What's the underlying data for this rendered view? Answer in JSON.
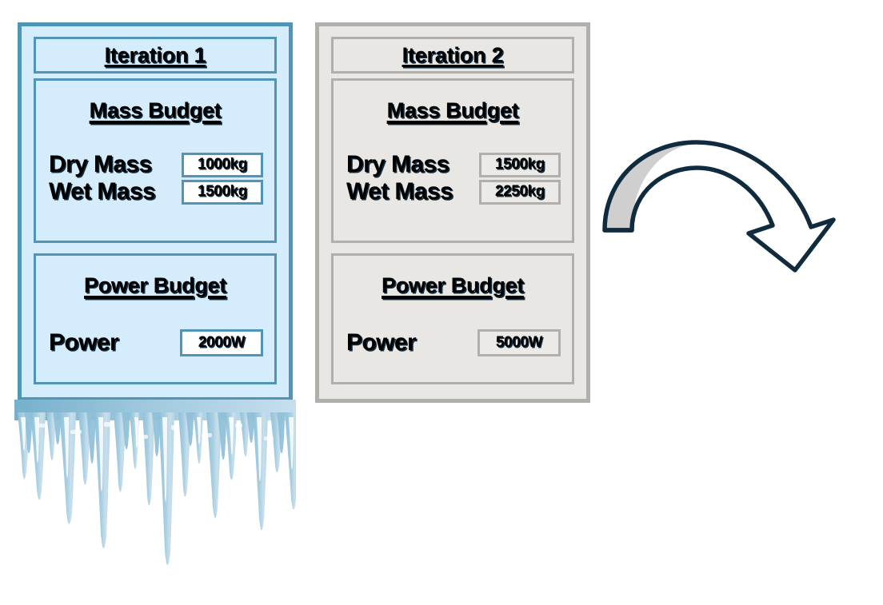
{
  "diagram": {
    "type": "iteration-comparison",
    "description": "Two iteration panels showing mass and power budgets, with a curved arrow indicating progression from iteration 1 to iteration 2. Iteration 1 panel is frozen/obsolete, depicted with icicles.",
    "colors": {
      "iter1_fill": "#d4ecfb",
      "iter1_border": "#4f95b8",
      "iter2_fill": "#e8e7e3",
      "iter2_border": "#b0afab",
      "value_box_fill_1": "#ffffff",
      "value_box_fill_2": "#eceae6",
      "arrow_outline": "#0f2b3d",
      "arrow_fill_left": "#cfcfcf",
      "arrow_fill_right": "#ffffff",
      "icicle_blue": "#8fc0d8",
      "icicle_light": "#c3dcea",
      "text": "#000000"
    }
  },
  "panels": [
    {
      "id": "iteration-1",
      "title": "Iteration 1",
      "sections": [
        {
          "id": "mass-budget",
          "heading": "Mass Budget",
          "rows": [
            {
              "label": "Dry Mass",
              "value": "1000kg"
            },
            {
              "label": "Wet Mass",
              "value": "1500kg"
            }
          ]
        },
        {
          "id": "power-budget",
          "heading": "Power Budget",
          "rows": [
            {
              "label": "Power",
              "value": "2000W"
            }
          ]
        }
      ]
    },
    {
      "id": "iteration-2",
      "title": "Iteration 2",
      "sections": [
        {
          "id": "mass-budget",
          "heading": "Mass Budget",
          "rows": [
            {
              "label": "Dry Mass",
              "value": "1500kg"
            },
            {
              "label": "Wet Mass",
              "value": "2250kg"
            }
          ]
        },
        {
          "id": "power-budget",
          "heading": "Power Budget",
          "rows": [
            {
              "label": "Power",
              "value": "5000W"
            }
          ]
        }
      ]
    }
  ],
  "decorations": {
    "icicles": {
      "name": "icicles-frozen-overlay",
      "attached_to": "iteration-1"
    },
    "arrow": {
      "name": "curved-loop-arrow",
      "direction": "clockwise-down-right"
    }
  }
}
